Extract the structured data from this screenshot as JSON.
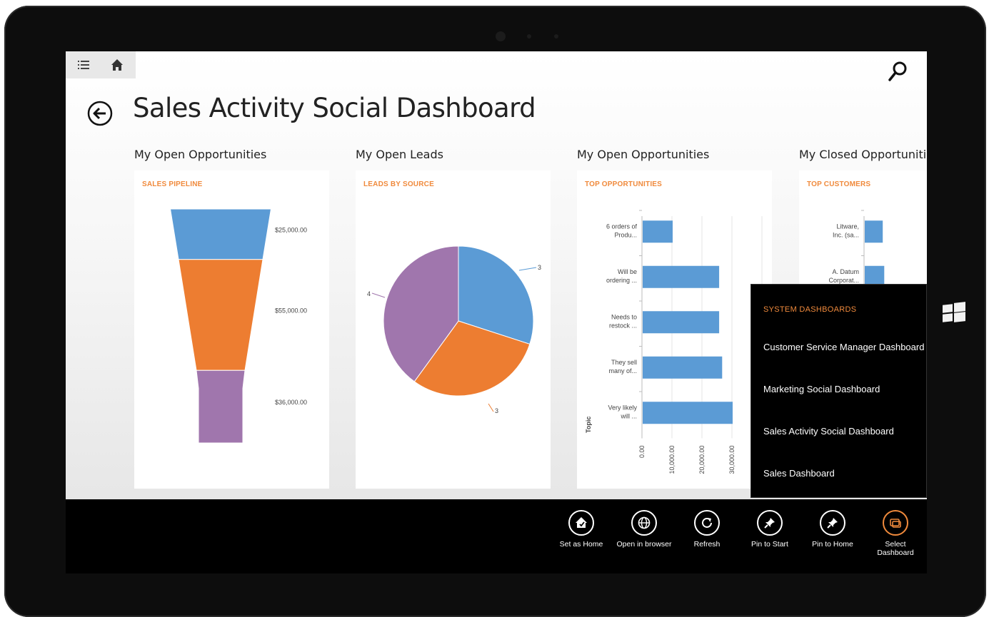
{
  "app": {
    "title": "Sales Activity Social Dashboard",
    "nav": {
      "menu_icon": "list-icon",
      "home_icon": "home-icon",
      "search_icon": "search-icon",
      "back_icon": "back-arrow-icon"
    }
  },
  "colors": {
    "accent": "#f08a3c",
    "blue": "#5b9bd5",
    "orange": "#ed7d31",
    "purple": "#a076ad",
    "appbar": "#000000"
  },
  "sections": [
    {
      "title": "My Open Opportunities",
      "card_title": "SALES PIPELINE"
    },
    {
      "title": "My Open Leads",
      "card_title": "LEADS BY SOURCE"
    },
    {
      "title": "My Open Opportunities",
      "card_title": "TOP OPPORTUNITIES"
    },
    {
      "title": "My Closed Opportunities",
      "card_title": "TOP CUSTOMERS"
    }
  ],
  "chart_data": [
    {
      "type": "funnel",
      "title": "SALES PIPELINE",
      "stages": [
        {
          "value": 25000,
          "label": "$25,000.00",
          "color": "#5b9bd5"
        },
        {
          "value": 55000,
          "label": "$55,000.00",
          "color": "#ed7d31"
        },
        {
          "value": 36000,
          "label": "$36,000.00",
          "color": "#a076ad"
        }
      ]
    },
    {
      "type": "pie",
      "title": "LEADS BY SOURCE",
      "slices": [
        {
          "value": 3,
          "label": "3",
          "color": "#5b9bd5"
        },
        {
          "value": 3,
          "label": "3",
          "color": "#ed7d31"
        },
        {
          "value": 4,
          "label": "4",
          "color": "#a076ad"
        }
      ]
    },
    {
      "type": "bar",
      "orientation": "horizontal",
      "title": "TOP OPPORTUNITIES",
      "ylabel": "Topic",
      "categories": [
        [
          "6 orders of",
          "Produ..."
        ],
        [
          "Will be",
          "ordering ..."
        ],
        [
          "Needs to",
          "restock ..."
        ],
        [
          "They sell",
          "many of..."
        ],
        [
          "Very likely",
          "will ..."
        ]
      ],
      "values": [
        10000,
        25500,
        25500,
        26500,
        30000
      ],
      "xticks": [
        "0.00",
        "10,000.00",
        "20,000.00",
        "30,000.00"
      ],
      "xlim": [
        0,
        40000
      ],
      "color": "#5b9bd5"
    },
    {
      "type": "bar",
      "orientation": "horizontal",
      "title": "TOP CUSTOMERS",
      "categories": [
        [
          "Litware,",
          "Inc. (sa..."
        ],
        [
          "A. Datum",
          "Corporat..."
        ]
      ],
      "values": [
        6000,
        6500
      ],
      "xlim": [
        0,
        40000
      ],
      "color": "#5b9bd5"
    }
  ],
  "flyout": {
    "header": "SYSTEM DASHBOARDS",
    "items": [
      "Customer Service Manager Dashboard",
      "Marketing Social Dashboard",
      "Sales Activity Social Dashboard",
      "Sales Dashboard"
    ]
  },
  "appbar": {
    "buttons": [
      {
        "label": "Set as Home",
        "icon": "set-home-icon"
      },
      {
        "label": "Open in browser",
        "icon": "globe-icon"
      },
      {
        "label": "Refresh",
        "icon": "refresh-icon"
      },
      {
        "label": "Pin to Start",
        "icon": "pin-icon"
      },
      {
        "label": "Pin to Home",
        "icon": "pin-icon"
      },
      {
        "label": "Select\nDashboard",
        "icon": "select-dashboard-icon"
      }
    ]
  }
}
